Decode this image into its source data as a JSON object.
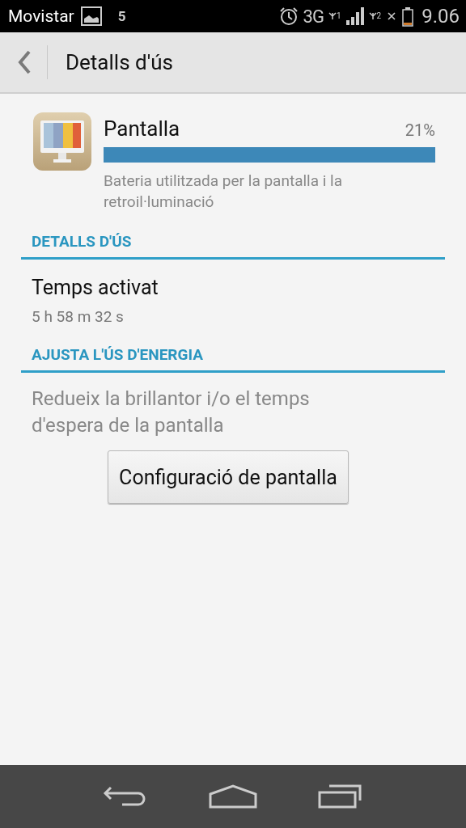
{
  "status_bar": {
    "carrier": "Movistar",
    "notification_count": "5",
    "network": "3G",
    "sim1": "1",
    "sim2": "2",
    "time": "9.06"
  },
  "action_bar": {
    "title": "Detalls d'ús"
  },
  "usage": {
    "name": "Pantalla",
    "percent": "21%",
    "level": 1,
    "description": "Bateria utilitzada per la pantalla i la retroil·luminació"
  },
  "sections": [
    {
      "header": "DETALLS D'ÚS",
      "kind": "detail",
      "label": "Temps activat",
      "value": "5 h 58 m 32 s"
    },
    {
      "header": "AJUSTA L'ÚS D'ENERGIA",
      "kind": "action",
      "text": "Redueix la brillantor i/o el temps d'espera de la pantalla",
      "button": "Configuració de pantalla"
    }
  ]
}
